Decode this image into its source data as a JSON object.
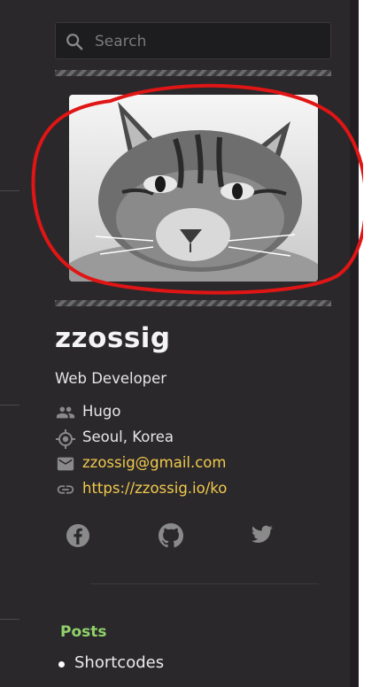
{
  "search": {
    "placeholder": "Search"
  },
  "author": {
    "name": "zzossig",
    "bio": "Web Developer",
    "organization": {
      "icon": "people-icon",
      "text": "Hugo"
    },
    "location": {
      "icon": "target-location-icon",
      "text": "Seoul, Korea"
    },
    "email": {
      "icon": "envelope-icon",
      "text": "zzossig@gmail.com"
    },
    "website": {
      "icon": "chain-link-icon",
      "text": "https://zzossig.io/ko"
    }
  },
  "social": [
    "facebook-icon",
    "github-icon",
    "twitter-icon"
  ],
  "nav": {
    "heading": "Posts",
    "items": [
      "Shortcodes"
    ]
  },
  "colors": {
    "background": "#2a282b",
    "link": "#f2c94c",
    "nav_heading": "#8fd16a",
    "annotation_circle": "#e01515"
  }
}
